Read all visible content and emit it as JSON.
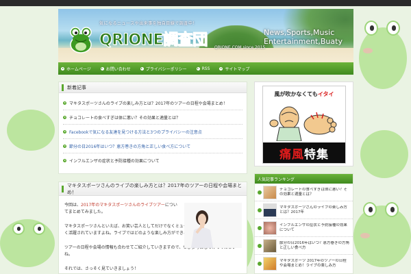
{
  "header": {
    "tagline": "気になるニュースや出来事を独自目線で調査中！",
    "logo": "QRIONE調査団",
    "logo_sub": "QRIONE.COM since 2015",
    "slogan_line1": "News,Sports,Music",
    "slogan_line2": "Entertainment,Buaty"
  },
  "nav": {
    "items": [
      "ホームページ",
      "お問い合わせ",
      "プライバシーポリシー",
      "RSS",
      "サイトマップ"
    ]
  },
  "new_posts": {
    "title": "新着記事",
    "items": [
      "マキタスポーツさんのライブの楽しみ方とは？2017年のツアーの日程や会場まとめ！",
      "チョコレートの食べすぎは体に悪い？その効果と適量とは？",
      "Facebookで気になる友達を見つける方法と3つのプライバシーの注意点",
      "節分の日2016年はいつ？恵方巻きの方角と正しい食べ方について",
      "インフルエンザの症状と予防接種の効果について"
    ]
  },
  "article": {
    "title": "マキタスポーツさんのライブの楽しみ方とは？2017年のツアーの日程や会場まとめ！",
    "p1_before": "今回は、",
    "p1_red": "2017年のマキタスポーツさんのライブツアー",
    "p1_after": "についてまとめてみました。",
    "p2": "マキタスポーツさんといえば、お笑い芸人としてだけでなくミュージシャンや俳優としても幅広く活躍されていますよね。ライブではどのような楽しみ方ができるのでしょうか？",
    "p3": "ツアーの日程や会場の情報も合わせてご紹介していきますので、ぜひ参考にしてみてくださいね。",
    "p4": "それでは、さっそく見ていきましょう！"
  },
  "ad": {
    "top_line_before": "風が吹かなくても",
    "top_line_red": "イタイ",
    "bottom_red": "痛風",
    "bottom_white": "特集"
  },
  "ranking": {
    "title": "人気記事ランキング",
    "items": [
      "チョコレートの食べすぎは体に悪い？その効果と適量とは？",
      "マキタスポーツさんのライブの楽しみ方とは？2017年",
      "インフルエンザの症状と予防接種の効果について",
      "節分の日2016年はいつ？恵方巻きの方角と正しい食べ方",
      "マキタスポーツ 2017年のツアーの日程や会場まとめ！ライブの楽しみ方"
    ]
  },
  "colors": {
    "accent_green": "#4a9a25",
    "topbar": "#2a2a2a",
    "ad_red": "#d91c1c"
  }
}
